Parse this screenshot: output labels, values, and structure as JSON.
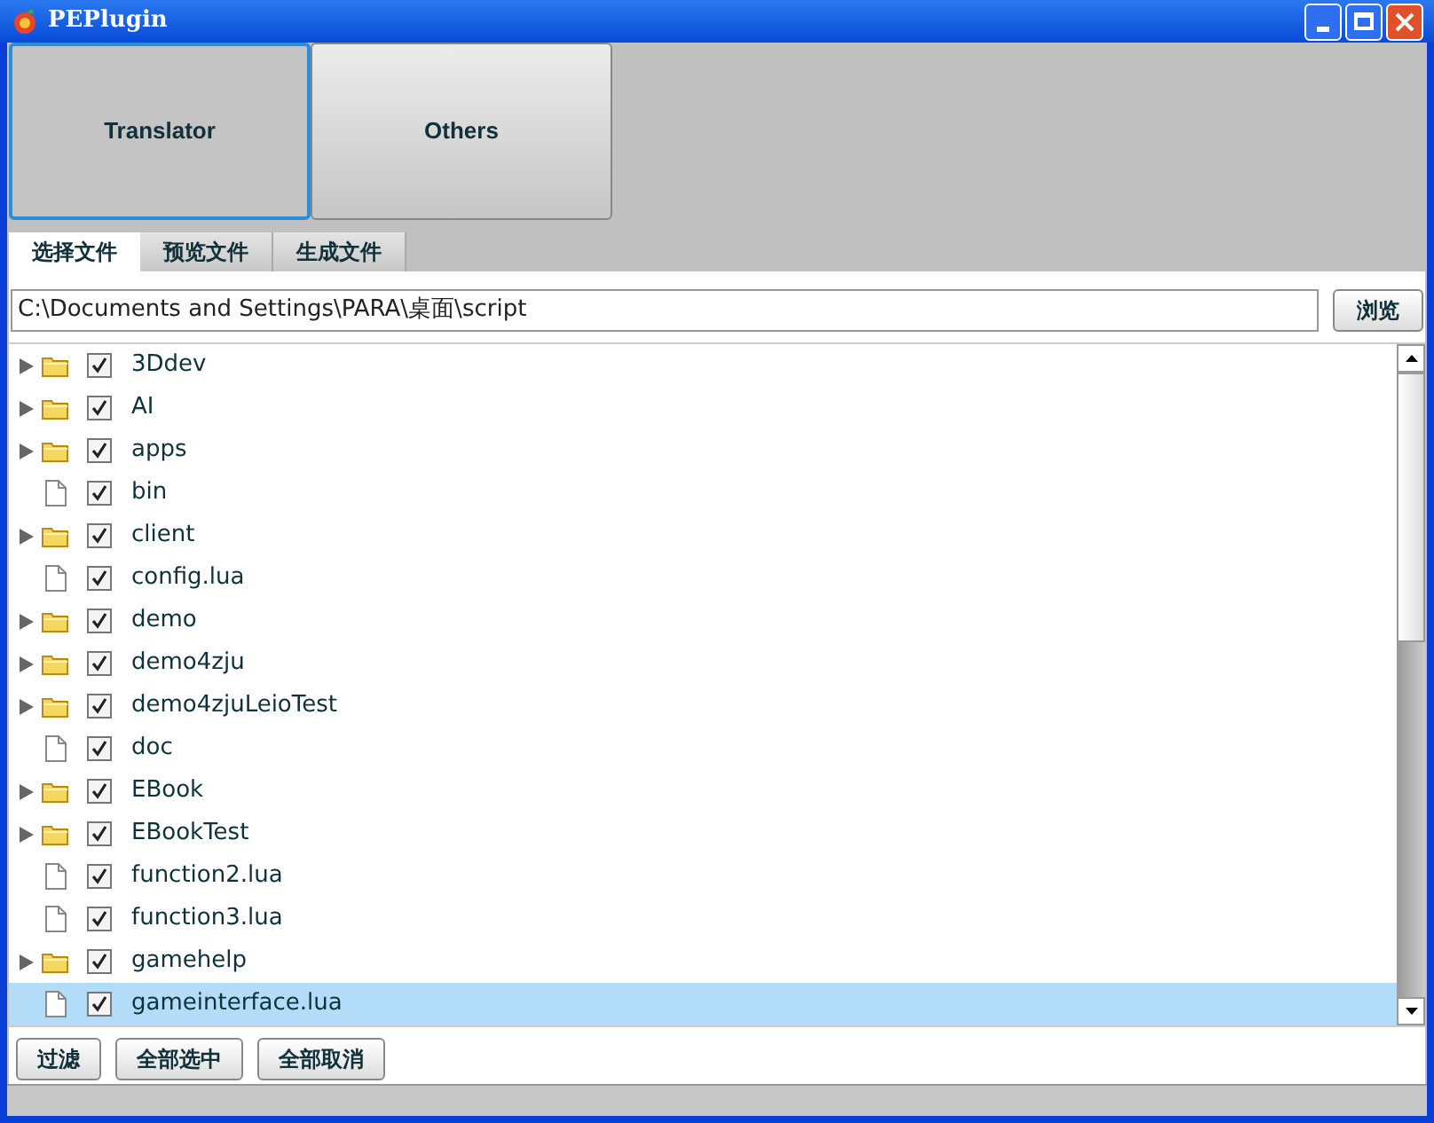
{
  "window": {
    "title": "PEPlugin"
  },
  "modules": [
    {
      "label": "Translator",
      "selected": true
    },
    {
      "label": "Others",
      "selected": false
    }
  ],
  "tabs": [
    {
      "label": "选择文件",
      "selected": true
    },
    {
      "label": "预览文件",
      "selected": false
    },
    {
      "label": "生成文件",
      "selected": false
    }
  ],
  "path": {
    "value": "C:\\Documents and Settings\\PARA\\桌面\\script",
    "browse_button": "浏览"
  },
  "files": [
    {
      "name": "3Ddev",
      "kind": "folder",
      "checked": true,
      "selected": false
    },
    {
      "name": "AI",
      "kind": "folder",
      "checked": true,
      "selected": false
    },
    {
      "name": "apps",
      "kind": "folder",
      "checked": true,
      "selected": false
    },
    {
      "name": "bin",
      "kind": "file",
      "checked": true,
      "selected": false
    },
    {
      "name": "client",
      "kind": "folder",
      "checked": true,
      "selected": false
    },
    {
      "name": "config.lua",
      "kind": "file",
      "checked": true,
      "selected": false
    },
    {
      "name": "demo",
      "kind": "folder",
      "checked": true,
      "selected": false
    },
    {
      "name": "demo4zju",
      "kind": "folder",
      "checked": true,
      "selected": false
    },
    {
      "name": "demo4zjuLeioTest",
      "kind": "folder",
      "checked": true,
      "selected": false
    },
    {
      "name": "doc",
      "kind": "file",
      "checked": true,
      "selected": false
    },
    {
      "name": "EBook",
      "kind": "folder",
      "checked": true,
      "selected": false
    },
    {
      "name": "EBookTest",
      "kind": "folder",
      "checked": true,
      "selected": false
    },
    {
      "name": "function2.lua",
      "kind": "file",
      "checked": true,
      "selected": false
    },
    {
      "name": "function3.lua",
      "kind": "file",
      "checked": true,
      "selected": false
    },
    {
      "name": "gamehelp",
      "kind": "folder",
      "checked": true,
      "selected": false
    },
    {
      "name": "gameinterface.lua",
      "kind": "file",
      "checked": true,
      "selected": true
    }
  ],
  "actions": [
    "过滤",
    "全部选中",
    "全部取消"
  ]
}
